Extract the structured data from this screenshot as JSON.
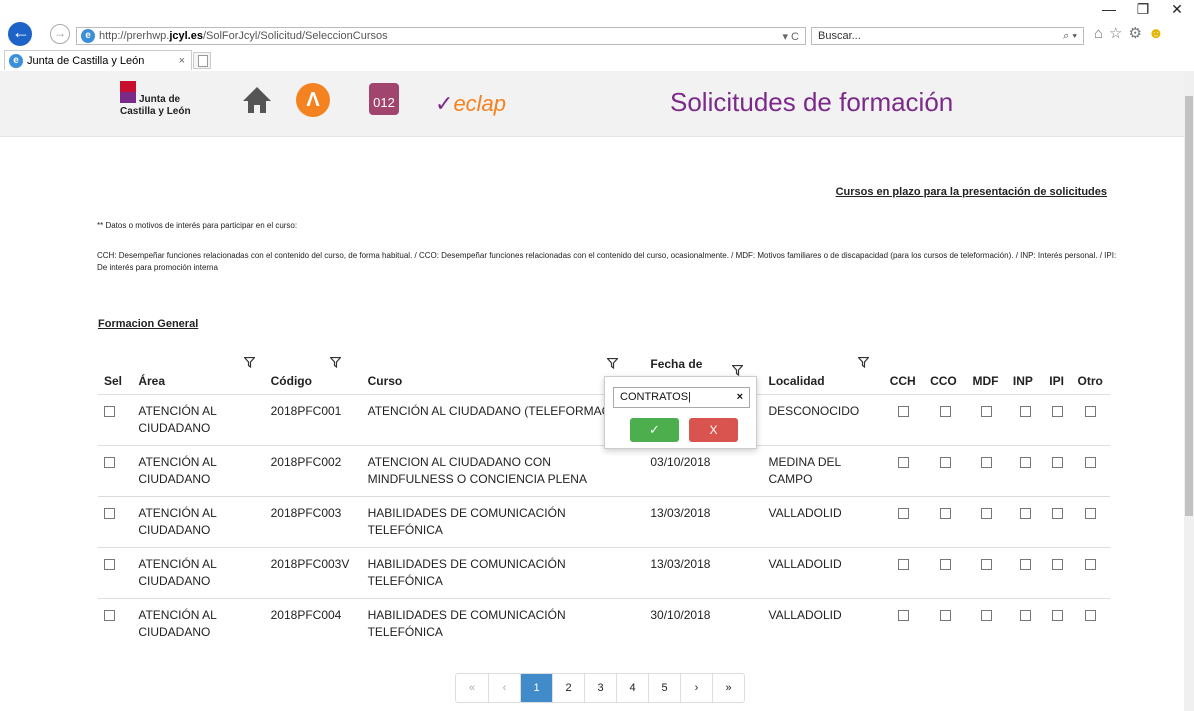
{
  "browser": {
    "url_prefix": "http://prerhwp.",
    "url_host": "jcyl.es",
    "url_path": "/SolForJcyl/Solicitud/SeleccionCursos",
    "addr_tools": "▾ C",
    "search_placeholder": "Buscar...",
    "search_icon": "⌕ ▾",
    "tab_title": "Junta de Castilla y León",
    "tab_close": "×",
    "win_min": "—",
    "win_restore": "❐",
    "win_close": "✕",
    "tool_icons": "⌂☆⚙"
  },
  "header": {
    "logo_line1": "Junta de",
    "logo_line2": "Castilla y León",
    "orange_glyph": "Λ",
    "icon012_label": "012",
    "eclap_prefix": "✓",
    "eclap_label": "eclap",
    "title": "Solicitudes de formación"
  },
  "top_link": "Cursos en plazo para la presentación de solicitudes",
  "notes": {
    "heading": "** Datos o motivos de interés para participar en el curso:",
    "legend": "CCH: Desempeñar funciones relacionadas con el contenido del curso, de forma habitual. / CCO: Desempeñar funciones relacionadas con el contenido del curso, ocasionalmente. / MDF: Motivos familiares o de discapacidad (para los cursos de teleformación). / INP: Interés personal. / IPI: De interés para promoción interna"
  },
  "section_title": "Formacion General",
  "columns": [
    "Sel",
    "Área",
    "Código",
    "Curso",
    "Fecha de",
    "Localidad",
    "CCH",
    "CCO",
    "MDF",
    "INP",
    "IPI",
    "Otro"
  ],
  "rows": [
    {
      "area": "ATENCIÓN AL CIUDADANO",
      "codigo": "2018PFC001",
      "curso": "ATENCIÓN AL CIUDADANO (TELEFORMACIÓN)",
      "fecha": "",
      "localidad": "DESCONOCIDO"
    },
    {
      "area": "ATENCIÓN AL CIUDADANO",
      "codigo": "2018PFC002",
      "curso": "ATENCION AL CIUDADANO CON MINDFULNESS O CONCIENCIA PLENA",
      "fecha": "03/10/2018",
      "localidad": "MEDINA DEL CAMPO"
    },
    {
      "area": "ATENCIÓN AL CIUDADANO",
      "codigo": "2018PFC003",
      "curso": "HABILIDADES DE COMUNICACIÓN TELEFÓNICA",
      "fecha": "13/03/2018",
      "localidad": "VALLADOLID"
    },
    {
      "area": "ATENCIÓN AL CIUDADANO",
      "codigo": "2018PFC003V",
      "curso": "HABILIDADES DE COMUNICACIÓN TELEFÓNICA",
      "fecha": "13/03/2018",
      "localidad": "VALLADOLID"
    },
    {
      "area": "ATENCIÓN AL CIUDADANO",
      "codigo": "2018PFC004",
      "curso": "HABILIDADES DE COMUNICACIÓN TELEFÓNICA",
      "fecha": "30/10/2018",
      "localidad": "VALLADOLID"
    }
  ],
  "filter_popup": {
    "value": "CONTRATOS",
    "clear": "×",
    "ok": "✓",
    "cancel": "X"
  },
  "pager": {
    "first": "«",
    "prev": "‹",
    "pages": [
      "1",
      "2",
      "3",
      "4",
      "5"
    ],
    "active": "1",
    "next": "›",
    "last": "»"
  },
  "colors": {
    "title_purple": "#7b2a8a",
    "pager_active": "#428bca",
    "ok_green": "#4cae4c",
    "cancel_red": "#d9534f"
  }
}
